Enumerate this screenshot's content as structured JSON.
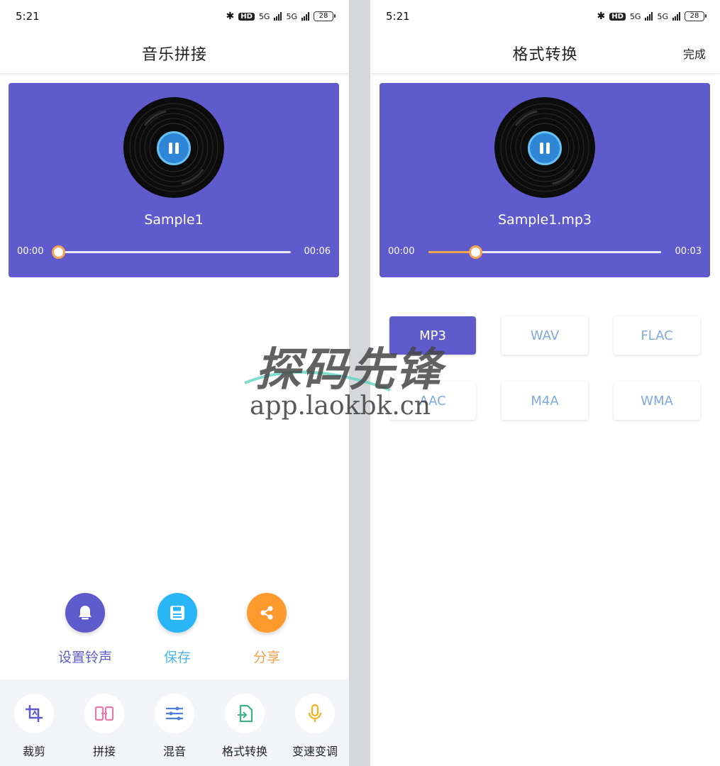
{
  "left": {
    "status": {
      "time": "5:21",
      "hd": "HD",
      "net1": "5G",
      "net2": "5G",
      "battery": "28"
    },
    "title": "音乐拼接",
    "player": {
      "track": "Sample1",
      "start_time": "00:00",
      "end_time": "00:06",
      "progress": 0
    },
    "actions": [
      {
        "label": "设置铃声",
        "color": "#5f5bcd",
        "icon": "bell-icon"
      },
      {
        "label": "保存",
        "color": "#29b6f6",
        "icon": "floppy-icon"
      },
      {
        "label": "分享",
        "color": "#ff9a2e",
        "icon": "share-icon"
      }
    ],
    "tools": [
      {
        "label": "裁剪",
        "icon": "crop-icon"
      },
      {
        "label": "拼接",
        "icon": "splice-icon"
      },
      {
        "label": "混音",
        "icon": "mixer-icon"
      },
      {
        "label": "格式转换",
        "icon": "convert-icon"
      },
      {
        "label": "变速变调",
        "icon": "microphone-icon"
      }
    ]
  },
  "right": {
    "status": {
      "time": "5:21",
      "hd": "HD",
      "net1": "5G",
      "net2": "5G",
      "battery": "28"
    },
    "title": "格式转换",
    "done_label": "完成",
    "player": {
      "track": "Sample1.mp3",
      "start_time": "00:00",
      "end_time": "00:03",
      "progress": 0.2
    },
    "formats": [
      {
        "label": "MP3",
        "selected": true
      },
      {
        "label": "WAV",
        "selected": false
      },
      {
        "label": "FLAC",
        "selected": false
      },
      {
        "label": "AAC",
        "selected": false
      },
      {
        "label": "M4A",
        "selected": false
      },
      {
        "label": "WMA",
        "selected": false
      }
    ]
  },
  "watermark": {
    "name": "探码先锋",
    "url": "app.laokbk.cn"
  },
  "colors": {
    "accent": "#5f5bcd",
    "progress": "#f5a54e",
    "format_text": "#7fa8dd"
  }
}
